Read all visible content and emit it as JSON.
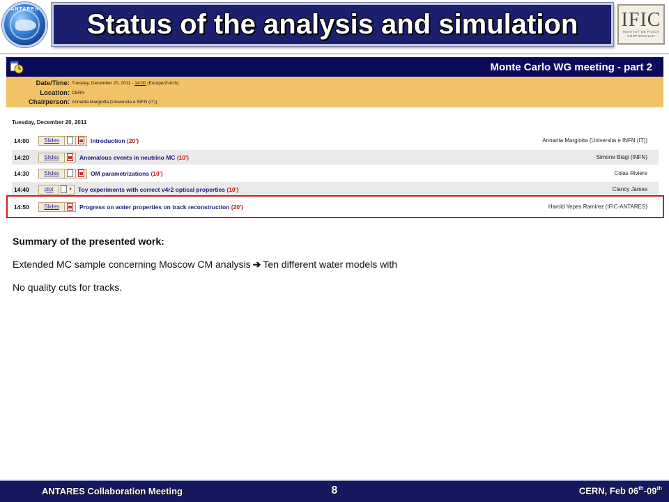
{
  "slide": {
    "title": "Status of the analysis and simulation",
    "logo_left_text": "ANTARES",
    "logo_right_text": "IFIC",
    "logo_right_sub1": "INSTITUT DE FISICA",
    "logo_right_sub2": "CORPUSCULAR"
  },
  "meeting": {
    "title": "Monte Carlo WG meeting - part 2",
    "datetime_label": "Date/Time:",
    "datetime_prefix": "Tuesday, December 20, 2011 - ",
    "datetime_time": "14:00",
    "datetime_suffix": " (Europe/Zurich)",
    "location_label": "Location:",
    "location": "CERN",
    "chair_label": "Chairperson:",
    "chair": "Annarita Margiotta (Universita e INFN (IT))",
    "day": "Tuesday, December 20, 2011"
  },
  "talks": [
    {
      "time": "14:00",
      "button": "Slides",
      "title": "Introduction",
      "duration": "(20')",
      "speaker": "Annarita Margiotta (Universita e INFN (IT))"
    },
    {
      "time": "14:20",
      "button": "Slides",
      "title": "Anomalous events in neutrino MC",
      "duration": "(10')",
      "speaker": "Simone Biagi (INFN)"
    },
    {
      "time": "14:30",
      "button": "Slides",
      "title": "OM parametrizations",
      "duration": "(10')",
      "speaker": "Colas Riviere"
    },
    {
      "time": "14:40",
      "button": "plot",
      "title": "Toy experiments with correct v4r2 optical properties",
      "duration": "(10')",
      "speaker": "Clancy James"
    },
    {
      "time": "14:50",
      "button": "Slides",
      "title": "Progress on water properties on track reconstruction",
      "duration": "(20')",
      "speaker": "Harold Yepes Ramirez (IFIC-ANTARES)"
    }
  ],
  "content": {
    "summary_heading": "Summary of the presented work:",
    "line1_before": "Extended MC sample concerning Moscow CM analysis",
    "line1_arrow": "➔",
    "line1_after": "Ten different water models with",
    "line2": "No quality cuts for tracks."
  },
  "footer": {
    "left": "ANTARES Collaboration Meeting",
    "page": "8",
    "right_prefix": "CERN, Feb 06",
    "right_sup1": "th",
    "right_mid": "-09",
    "right_sup2": "th"
  },
  "colors": {
    "title_bg": "#1a1f6e",
    "meeting_header_bg": "#0b0b5c",
    "info_bg": "#f2c266",
    "highlight": "#d31c1c",
    "footer_bg": "#16185f"
  }
}
